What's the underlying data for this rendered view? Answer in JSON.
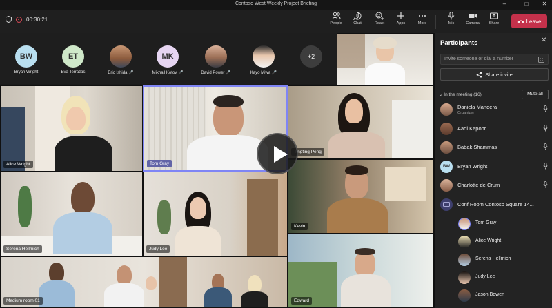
{
  "window": {
    "title": "Contoso West Weekly Project Briefing"
  },
  "toolbar": {
    "timer": "00:30:21",
    "buttons": [
      {
        "label": "People",
        "icon": "people-icon"
      },
      {
        "label": "Chat",
        "icon": "chat-icon"
      },
      {
        "label": "React",
        "icon": "react-icon"
      },
      {
        "label": "Apps",
        "icon": "apps-icon"
      },
      {
        "label": "More",
        "icon": "more-icon"
      },
      {
        "label": "Mic",
        "icon": "mic-icon"
      },
      {
        "label": "Camera",
        "icon": "camera-icon"
      },
      {
        "label": "Share",
        "icon": "share-icon"
      }
    ],
    "leave_label": "Leave"
  },
  "strip": {
    "participants": [
      {
        "name": "Bryan Wright",
        "initials": "BW",
        "color": "#b9dff0"
      },
      {
        "name": "Eva Terrazas",
        "initials": "ET",
        "color": "#cfe8c9"
      },
      {
        "name": "Eric Ishida",
        "initials": "",
        "color": ""
      },
      {
        "name": "Mikhail Kotov",
        "initials": "MK",
        "color": "#e6d5f2"
      },
      {
        "name": "David Power",
        "initials": "",
        "color": ""
      },
      {
        "name": "Kayo Miwa",
        "initials": "",
        "color": ""
      }
    ],
    "more_count": "+2"
  },
  "tiles": {
    "alice": "Alice Wright",
    "tom": "Tom Gray",
    "tingting": "Tingting Peng",
    "serena": "Serena Hellmich",
    "judy": "Judy Lee",
    "kevin": "Kevin",
    "medium_room": "Medium room 01",
    "edward": "Edward"
  },
  "panel": {
    "title": "Participants",
    "invite_placeholder": "Invite someone or dial a number",
    "share_invite": "Share invite",
    "in_meeting": "In the meeting (16)",
    "mute_all": "Mute all",
    "people": [
      {
        "name": "Daniela Mandera",
        "role": "Organizer"
      },
      {
        "name": "Aadi Kapoor",
        "role": ""
      },
      {
        "name": "Babak Shammas",
        "role": ""
      },
      {
        "name": "Bryan Wright",
        "role": "",
        "initials": "BW"
      },
      {
        "name": "Charlotte de Crum",
        "role": ""
      },
      {
        "name": "Conf Room Contoso Square 14...",
        "role": ""
      }
    ],
    "room_members": [
      "Tom Gray",
      "Alice Wright",
      "Serena Hellmich",
      "Judy Lee",
      "Jason Bowen"
    ]
  }
}
